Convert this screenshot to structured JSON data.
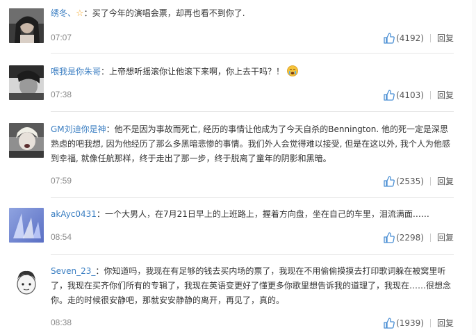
{
  "comments": [
    {
      "user": "绣冬、",
      "badge_icon": "star-icon",
      "text": "买了今年的演唱会票，却再也看不到你了.",
      "time": "07:07",
      "likes": "(4192)",
      "reply": "回复"
    },
    {
      "user": "喂我是你朱哥",
      "text": "上帝想听摇滚你让他滚下来啊，你上去干吗？！",
      "emoji": "crying-face-emoji",
      "time": "07:38",
      "likes": "(4103)",
      "reply": "回复"
    },
    {
      "user": "GM刘迪你是神",
      "text": "他不是因为事故而死亡, 经历的事情让他成为了今天自杀的Bennington. 他的死一定是深思熟虑的吧我想, 因为他经历了那么多黑暗悲惨的事情。我们外人会觉得难以接受, 但是在这以外, 我个人为他感到幸福, 就像任航那样，终于走出了那一步，终于脱离了童年的阴影和黑暗。",
      "time": "07:59",
      "likes": "(2535)",
      "reply": "回复"
    },
    {
      "user": "akAyc0431",
      "text": "一个大男人，在7月21日早上的上班路上，握着方向盘，坐在自己的车里，泪流满面……",
      "time": "08:54",
      "likes": "(2298)",
      "reply": "回复"
    },
    {
      "user": "Seven_23_",
      "text": "你知道吗，我现在有足够的钱去买内场的票了，我现在不用偷偷摸摸去打印歌词躲在被窝里听了，我现在买齐你们所有的专辑了，我现在英语变更好了懂更多你歌里想告诉我的道理了，我现在……很想念你。走的时候很安静吧，那就安安静静的离开，再见了，真的。",
      "time": "08:38",
      "likes": "(1939)",
      "reply": "回复"
    }
  ],
  "icons": {
    "like": "thumbs-up-icon"
  },
  "colors": {
    "username": "#3a7ec2",
    "like_icon": "#4a8fd4",
    "time": "#8a8a8a"
  }
}
